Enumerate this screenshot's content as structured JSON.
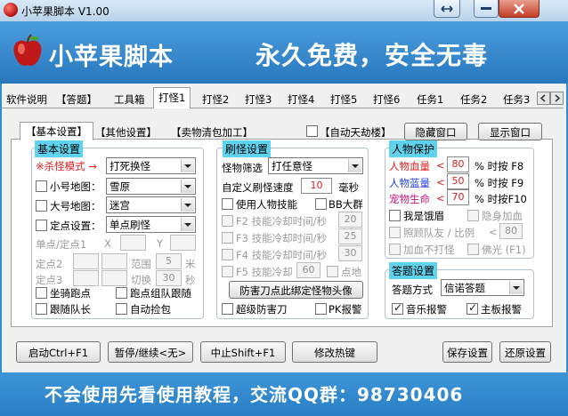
{
  "window": {
    "title": "小苹果脚本 V1.00"
  },
  "banner": {
    "app_name": "小苹果脚本",
    "slogan": "永久免费，安全无毒"
  },
  "main_tabs": [
    "软件说明",
    "【答题】",
    "工具箱",
    "打怪1",
    "打怪2",
    "打怪3",
    "打怪4",
    "打怪5",
    "打怪6",
    "任务1",
    "任务2",
    "任务3"
  ],
  "active_tab": "打怪1",
  "sub_tabs": [
    "【基本设置】",
    "【其他设置】",
    "【卖物清包加工】"
  ],
  "top_right": {
    "auto_robbery_label": "【自动天劫楼】",
    "hide_window": "隐藏窗口",
    "show_window": "显示窗口"
  },
  "basic": {
    "title": "基本设置",
    "kill_mode_label": "※杀怪模式 →",
    "kill_mode_value": "打死换怪",
    "small_map_label": "小号地图：",
    "small_map_value": "雪原",
    "big_map_label": "大号地图：",
    "big_map_value": "迷宫",
    "fixed_point_label": "定点设置：",
    "fixed_point_value": "单点刷怪",
    "point1_label": "单点/定点1",
    "x_label": "X",
    "y_label": "Y",
    "point2_label": "定点2",
    "range_label": "范围",
    "range_value": "5",
    "meter_label": "米",
    "point3_label": "定点3",
    "switch_label": "切换",
    "switch_value": "30",
    "second_label": "秒",
    "mount_run": "坐骑跑点",
    "follow_group": "跑点组队跟随",
    "follow_leader": "跟随队长",
    "auto_pickup": "自动捡包"
  },
  "farm": {
    "title": "刷怪设置",
    "filter_label": "怪物筛选",
    "filter_value": "打任意怪",
    "speed_label": "自定义刷怪速度",
    "speed_value": "10",
    "ms_label": "毫秒",
    "use_skills": "使用人物技能",
    "bb_group": "BB大群",
    "f2_label": "F2 技能冷却时间/秒",
    "f2_value": "20",
    "f3_label": "F3 技能冷却时间/秒",
    "f3_value": "25",
    "f4_label": "F4 技能冷却时间/秒",
    "f4_value": "30",
    "f5_label": "F5 技能冷却",
    "f5_value": "60",
    "point_crit": "点地",
    "bind_button": "防害刀点此绑定怪物头像",
    "super_defense": "超级防害刀",
    "pk_alarm": "PK报警"
  },
  "protect": {
    "title": "人物保护",
    "hp_label": "人物血量",
    "hp_value": "80",
    "hp_key": "% 时按 F8",
    "mp_label": "人物蓝量",
    "mp_value": "50",
    "mp_key": "% 时按 F9",
    "pet_label": "宠物生命",
    "pet_value": "70",
    "pet_key": "% 时按F10",
    "lt": "<",
    "hungry": "我是饿眉",
    "stealth_add_blood": "隐身加血",
    "care_team": "照顾队友 / 比例",
    "care_lt": "<",
    "care_value": "80",
    "add_blood_no_fight": "加血不打怪",
    "buddha": "佛光 (F1)"
  },
  "answer": {
    "title": "答题设置",
    "mode_label": "答题方式",
    "mode_value": "信诺答题",
    "music_alarm": "音乐报警",
    "main_alarm": "主板报警"
  },
  "bottom_buttons": {
    "start": "启动Ctrl+F1",
    "pause": "暂停/继续<无>",
    "stop": "中止Shift+F1",
    "hotkey": "修改热键",
    "save": "保存设置",
    "restore": "还原设置"
  },
  "footer": {
    "text": "不会使用先看使用教程，交流QQ群：98730406"
  },
  "colors": {
    "banner": "#2f8fd0",
    "group_title": "#5fd3ee",
    "warn_red": "#e01b1b"
  },
  "icons": [
    "apple-icon",
    "restore-icon",
    "minimize-icon",
    "close-icon"
  ]
}
